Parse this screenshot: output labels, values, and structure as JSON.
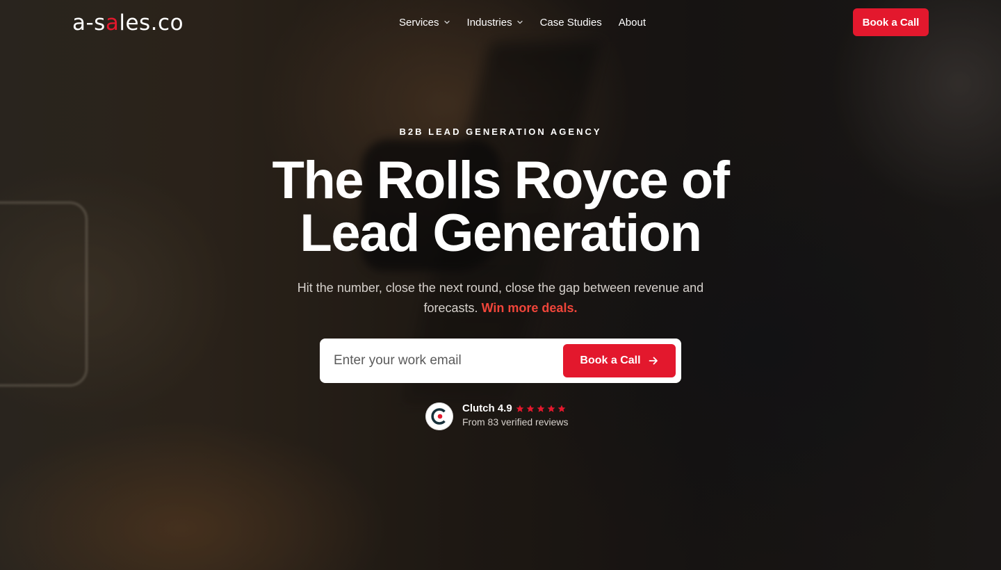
{
  "brand": {
    "logo_pre": "a-s",
    "logo_accent": "a",
    "logo_post": "les.co",
    "accent_color": "#e3182d"
  },
  "nav": {
    "items": [
      {
        "label": "Services",
        "has_dropdown": true
      },
      {
        "label": "Industries",
        "has_dropdown": true
      },
      {
        "label": "Case Studies",
        "has_dropdown": false
      },
      {
        "label": "About",
        "has_dropdown": false
      }
    ],
    "cta_label": "Book a Call"
  },
  "hero": {
    "eyebrow": "B2B LEAD GENERATION AGENCY",
    "title_line1": "The Rolls Royce of",
    "title_line2": "Lead Generation",
    "subtitle": "Hit the number, close the next round, close the gap between revenue and forecasts.",
    "subtitle_highlight": "Win more deals."
  },
  "form": {
    "email_placeholder": "Enter your work email",
    "email_value": "",
    "submit_label": "Book a Call",
    "submit_icon": "arrow-right-icon"
  },
  "rating": {
    "source": "Clutch",
    "score": "4.9",
    "stars": 5,
    "reviews_text": "From 83 verified reviews",
    "star_color": "#e3182d"
  }
}
